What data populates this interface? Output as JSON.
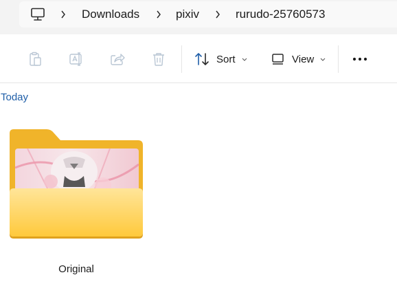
{
  "address_bar": {
    "breadcrumbs": [
      "Downloads",
      "pixiv",
      "rurudo-25760573"
    ],
    "root_icon": "this-pc-icon",
    "separator_icon": "chevron-right-icon"
  },
  "command_bar": {
    "icons": [
      "paste-icon",
      "rename-icon",
      "share-icon",
      "delete-icon"
    ],
    "sort_label": "Sort",
    "view_label": "View",
    "more_icon": "more-options-icon"
  },
  "content": {
    "group_title": "Today",
    "items": [
      {
        "name": "Original",
        "type": "folder",
        "icon": "folder-with-preview-icon"
      }
    ]
  },
  "colors": {
    "group_title": "#1f5ea8",
    "folder_back": "#f0b42a",
    "folder_front": "#ffd966",
    "command_icon_disabled": "#b9c6d4"
  }
}
